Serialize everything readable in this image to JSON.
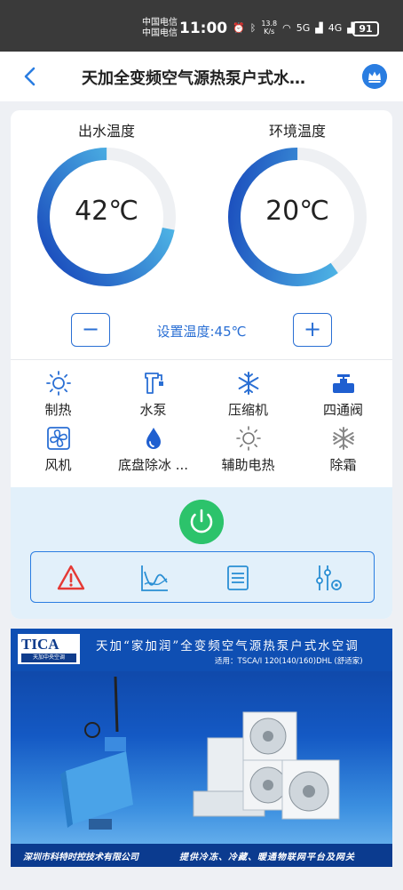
{
  "status_bar": {
    "carrier1": "中国电信",
    "carrier2": "中国电信",
    "time": "11:00",
    "net_speed_value": "13.8",
    "net_speed_unit": "K/s",
    "signal1": "5G",
    "signal2": "4G",
    "battery": "91"
  },
  "header": {
    "title": "天加全变频空气源热泵户式水…"
  },
  "gauges": [
    {
      "label": "出水温度",
      "value": "42℃",
      "level": 0.72
    },
    {
      "label": "环境温度",
      "value": "20℃",
      "level": 0.6
    }
  ],
  "setpoint": {
    "minus": "−",
    "plus": "+",
    "text": "设置温度:45℃"
  },
  "features": [
    {
      "label": "制热",
      "icon": "sun-icon"
    },
    {
      "label": "水泵",
      "icon": "pump-icon"
    },
    {
      "label": "压缩机",
      "icon": "snowflake-icon"
    },
    {
      "label": "四通阀",
      "icon": "valve-icon"
    },
    {
      "label": "风机",
      "icon": "fan-icon"
    },
    {
      "label": "底盘除冰 ...",
      "icon": "water-drop-icon"
    },
    {
      "label": "辅助电热",
      "icon": "sun-icon"
    },
    {
      "label": "除霜",
      "icon": "defrost-icon"
    }
  ],
  "toolbar": {
    "icons": [
      "warning-icon",
      "chart-curve-icon",
      "list-icon",
      "settings-sliders-icon"
    ]
  },
  "banner": {
    "logo": "TICA",
    "logo_sub": "天加中央空调",
    "title": "天加“家加润”全变频空气源热泵户式水空调",
    "model": "适用：TSCA/I 120(140/160)DHL (舒适家)",
    "company": "深圳市科特时控技术有限公司",
    "slogan": "提供冷冻、冷藏、暖通物联网平台及网关"
  },
  "colors": {
    "accent": "#2a6fd4",
    "gauge_start": "#1440b8",
    "gauge_end": "#5fd6f2",
    "power": "#2cc36b",
    "warning": "#e53935"
  }
}
